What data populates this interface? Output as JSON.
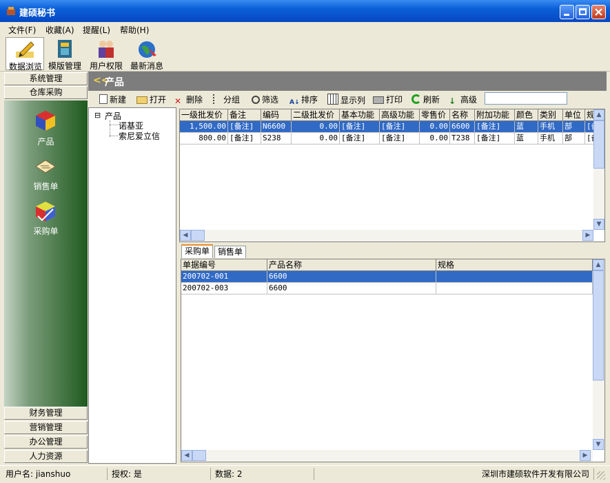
{
  "window": {
    "title": "建硕秘书"
  },
  "menu": [
    "文件(F)",
    "收藏(A)",
    "提醒(L)",
    "帮助(H)"
  ],
  "toolbar": [
    {
      "label": "数据浏览",
      "icon": "pencil-icon"
    },
    {
      "label": "模版管理",
      "icon": "template-icon"
    },
    {
      "label": "用户权限",
      "icon": "users-icon"
    },
    {
      "label": "最新消息",
      "icon": "globe-icon"
    }
  ],
  "nav": {
    "top": [
      "系统管理",
      "仓库采购"
    ],
    "items": [
      {
        "label": "产品",
        "icon": "product-cube-icon"
      },
      {
        "label": "销售单",
        "icon": "sales-form-icon"
      },
      {
        "label": "采购单",
        "icon": "purchase-cube-icon"
      }
    ],
    "bottom": [
      "财务管理",
      "营销管理",
      "办公管理",
      "人力资源"
    ]
  },
  "header": {
    "chevron": "<<",
    "title": "产品"
  },
  "subtoolbar": [
    "新建",
    "打开",
    "删除",
    "分组",
    "筛选",
    "排序",
    "显示列",
    "打印",
    "刷新",
    "高级"
  ],
  "search": {
    "value": ""
  },
  "tree": {
    "root_toggle": "⊟",
    "root": "产品",
    "children": [
      "诺基亚",
      "索尼爱立信"
    ]
  },
  "grid1": {
    "columns": [
      "一级批发价",
      "备注",
      "编码",
      "二级批发价",
      "基本功能",
      "高级功能",
      "零售价",
      "名称",
      "附加功能",
      "颜色",
      "类别",
      "单位",
      "规"
    ],
    "rows": [
      [
        "1,500.00",
        "[备注]",
        "N6600",
        "0.00",
        "[备注]",
        "[备注]",
        "0.00",
        "6600",
        "[备注]",
        "蓝",
        "手机",
        "部",
        "[备"
      ],
      [
        "800.00",
        "[备注]",
        "S238",
        "0.00",
        "[备注]",
        "[备注]",
        "0.00",
        "T238",
        "[备注]",
        "蓝",
        "手机",
        "部",
        "[备"
      ]
    ]
  },
  "tabs": [
    "采购单",
    "销售单"
  ],
  "grid2": {
    "columns": [
      "单据编号",
      "产品名称",
      "规格"
    ],
    "rows": [
      [
        "200702-001",
        "6600",
        ""
      ],
      [
        "200702-003",
        "6600",
        ""
      ]
    ]
  },
  "status": {
    "user": "用户名: jianshuo",
    "auth": "授权: 是",
    "data": "数据: 2",
    "company": "深圳市建硕软件开发有限公司"
  },
  "colors": {
    "titlebar": "#0a5fd8",
    "selection": "#316ac5",
    "header": "#7d7d7d",
    "chevron": "#f3d34a"
  }
}
